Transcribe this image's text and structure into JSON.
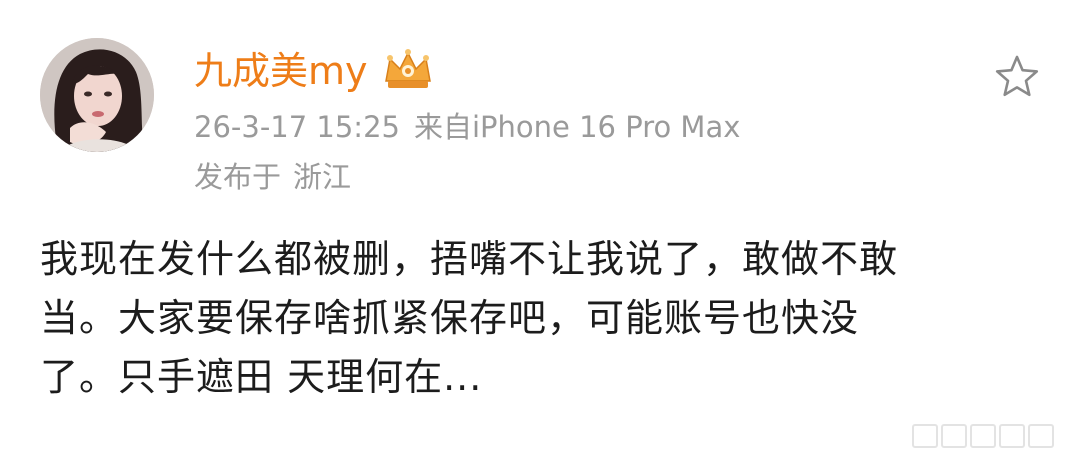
{
  "post": {
    "author": {
      "name": "九成美my",
      "avatar_icon": "profile-avatar",
      "badge_icon": "vip-crown-icon"
    },
    "timestamp": "26-3-17 15:25",
    "source": "来自iPhone 16 Pro Max",
    "location_prefix": "发布于",
    "location": "浙江",
    "content": "我现在发什么都被删，捂嘴不让我说了，敢做不敢\n当。大家要保存啥抓紧保存吧，可能账号也快没\n了。只手遮田 天理何在...",
    "favorite_icon": "star-outline-icon"
  },
  "colors": {
    "username": "#ee7d18",
    "meta": "#9a9a9a",
    "text": "#1c1c1c",
    "badge": "#f4a73a"
  }
}
